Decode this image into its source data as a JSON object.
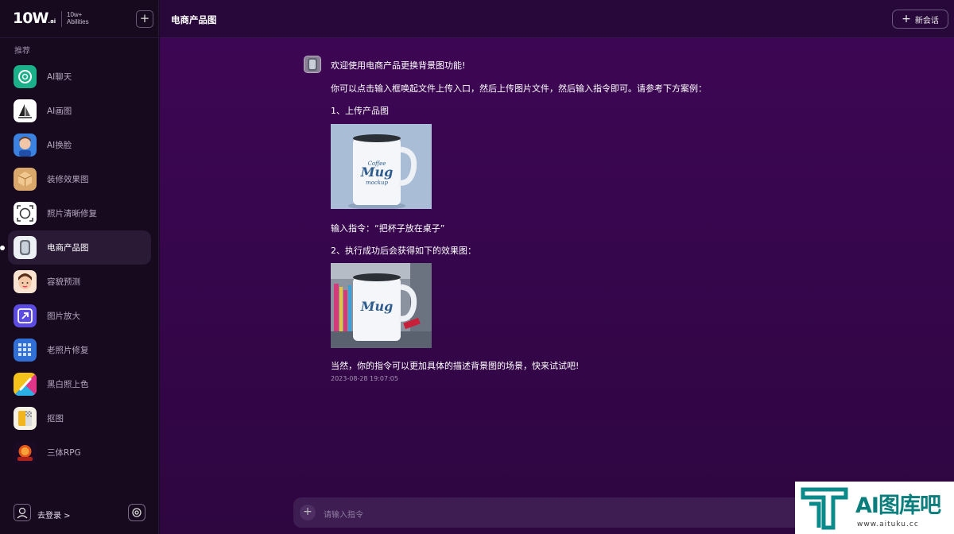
{
  "brand": {
    "logo": "10W",
    "logo_suffix": ".ai",
    "sub_line1": "10w+",
    "sub_line2": "Abilities"
  },
  "sidebar": {
    "section_label": "推荐",
    "items": [
      {
        "label": "AI聊天",
        "icon": "chatgpt-icon"
      },
      {
        "label": "AI画图",
        "icon": "sailboat-icon"
      },
      {
        "label": "AI换脸",
        "icon": "face-avatar-icon"
      },
      {
        "label": "装修效果图",
        "icon": "box-icon"
      },
      {
        "label": "照片清晰修复",
        "icon": "focus-target-icon"
      },
      {
        "label": "电商产品图",
        "icon": "product-cup-icon"
      },
      {
        "label": "容貌预测",
        "icon": "person-face-icon"
      },
      {
        "label": "图片放大",
        "icon": "expand-icon"
      },
      {
        "label": "老照片修复",
        "icon": "grid-photo-icon"
      },
      {
        "label": "黑白照上色",
        "icon": "paint-brush-icon"
      },
      {
        "label": "抠图",
        "icon": "cutout-icon"
      },
      {
        "label": "三体RPG",
        "icon": "game-planet-icon"
      }
    ],
    "active_index": 5,
    "login_text": "去登录 >"
  },
  "header": {
    "title": "电商产品图",
    "new_chat_label": "新会话"
  },
  "message": {
    "line1": "欢迎使用电商产品更换背景图功能!",
    "line2": "你可以点击输入框唤起文件上传入口，然后上传图片文件，然后输入指令即可。请参考下方案例：",
    "step1": "1、上传产品图",
    "instruction": "输入指令：“把杯子放在桌子”",
    "step2": "2、执行成功后会获得如下的效果图：",
    "closing": "当然，你的指令可以更加具体的描述背景图的场景，快来试试吧!",
    "timestamp": "2023-08-28 19:07:05",
    "image1_text_main": "Mug",
    "image1_text_top": "Coffee",
    "image1_text_bottom": "mockup"
  },
  "input": {
    "placeholder": "请输入指令"
  },
  "watermark": {
    "text": "AI图库吧",
    "url": "www.aituku.cc"
  },
  "colors": {
    "sidebar_bg": "#170a1f",
    "main_bg": "#3a0651",
    "topbar_bg": "#28083a",
    "accent_teal": "#0a7d7d"
  }
}
